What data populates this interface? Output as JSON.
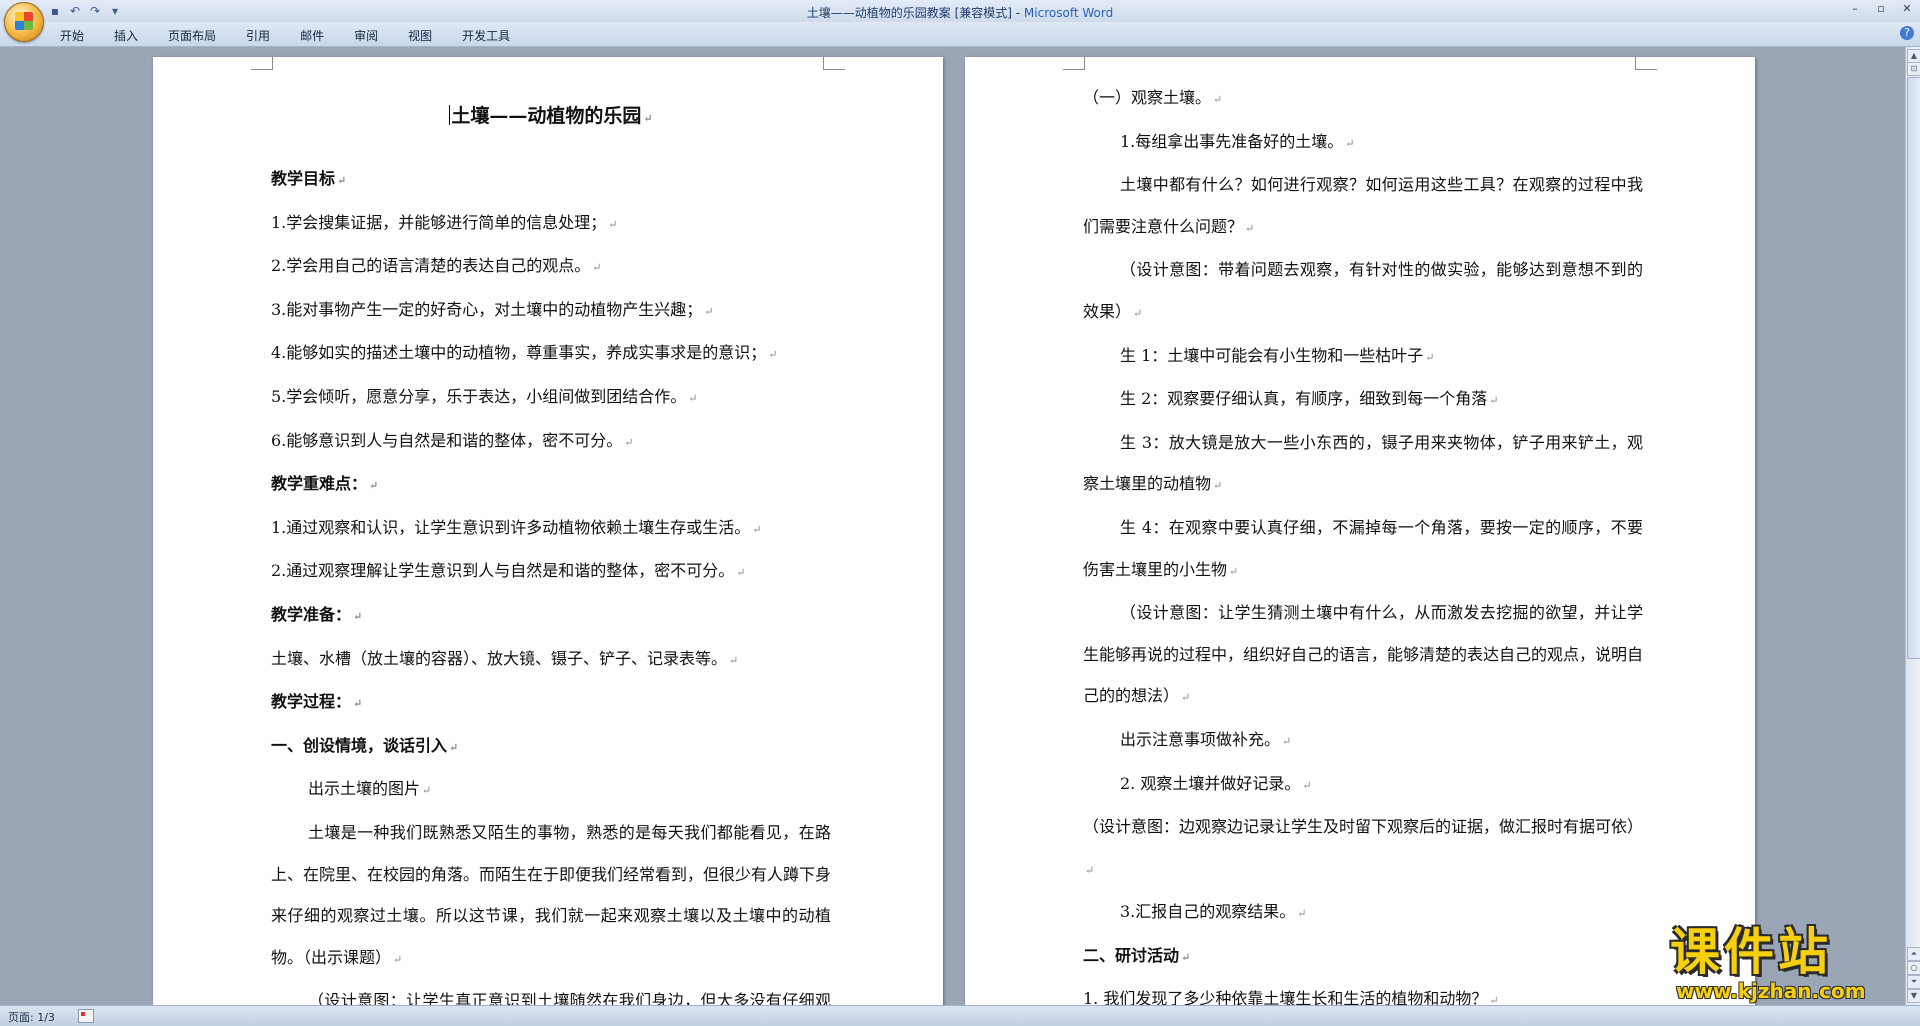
{
  "window": {
    "title": "土壤——动植物的乐园教案 [兼容模式] - ",
    "app_name": "Microsoft Word"
  },
  "quick_access": [
    {
      "name": "save-icon",
      "glyph": "▪"
    },
    {
      "name": "undo-icon",
      "glyph": "↶"
    },
    {
      "name": "redo-icon",
      "glyph": "↷"
    },
    {
      "name": "customize-icon",
      "glyph": "▾"
    }
  ],
  "ribbon": {
    "tabs": [
      "开始",
      "插入",
      "页面布局",
      "引用",
      "邮件",
      "审阅",
      "视图",
      "开发工具"
    ]
  },
  "document": {
    "left_page": {
      "title": "土壤——动植物的乐园",
      "paragraphs": [
        {
          "text": "教学目标",
          "style": "bold"
        },
        {
          "text": "1.学会搜集证据，并能够进行简单的信息处理；",
          "style": ""
        },
        {
          "text": "2.学会用自己的语言清楚的表达自己的观点。",
          "style": ""
        },
        {
          "text": "3.能对事物产生一定的好奇心，对土壤中的动植物产生兴趣；",
          "style": ""
        },
        {
          "text": "4.能够如实的描述土壤中的动植物，尊重事实，养成实事求是的意识；",
          "style": ""
        },
        {
          "text": "5.学会倾听，愿意分享，乐于表达，小组间做到团结合作。",
          "style": ""
        },
        {
          "text": "6.能够意识到人与自然是和谐的整体，密不可分。",
          "style": ""
        },
        {
          "text": "教学重难点：",
          "style": "bold"
        },
        {
          "text": "1.通过观察和认识，让学生意识到许多动植物依赖土壤生存或生活。",
          "style": ""
        },
        {
          "text": "2.通过观察理解让学生意识到人与自然是和谐的整体，密不可分。",
          "style": ""
        },
        {
          "text": "教学准备：",
          "style": "bold"
        },
        {
          "text": "土壤、水槽（放土壤的容器）、放大镜、镊子、铲子、记录表等。",
          "style": ""
        },
        {
          "text": "教学过程：",
          "style": "bold"
        },
        {
          "text": "一、创设情境，谈话引入",
          "style": "bold"
        },
        {
          "text": "出示土壤的图片",
          "style": "indent"
        },
        {
          "text": "土壤是一种我们既熟悉又陌生的事物，熟悉的是每天我们都能看见，在路上、在院里、在校园的角落。而陌生在于即便我们经常看到，但很少有人蹲下身来仔细的观察过土壤。所以这节课，我们就一起来观察土壤以及土壤中的动植物。（出示课题）",
          "style": "indent"
        },
        {
          "text": "（设计意图：让学生真正意识到土壤随然在我们身边，但大多没有仔细观察过土壤的世界，调动学生观察土壤的兴趣）",
          "style": "indent"
        }
      ]
    },
    "right_page": {
      "paragraphs": [
        {
          "text": "（一）观察土壤。",
          "style": ""
        },
        {
          "text": "1.每组拿出事先准备好的土壤。",
          "style": "indent"
        },
        {
          "text": "土壤中都有什么？如何进行观察？如何运用这些工具？在观察的过程中我们需要注意什么问题？",
          "style": "indent"
        },
        {
          "text": "（设计意图：带着问题去观察，有针对性的做实验，能够达到意想不到的效果）",
          "style": "indent"
        },
        {
          "text": "生 1：土壤中可能会有小生物和一些枯叶子",
          "style": "indent"
        },
        {
          "text": "生 2：观察要仔细认真，有顺序，细致到每一个角落",
          "style": "indent"
        },
        {
          "text": "生 3：放大镜是放大一些小东西的，镊子用来夹物体，铲子用来铲土，观察土壤里的动植物",
          "style": "indent"
        },
        {
          "text": "生 4：在观察中要认真仔细，不漏掉每一个角落，要按一定的顺序，不要伤害土壤里的小生物",
          "style": "indent"
        },
        {
          "text": "（设计意图：让学生猜测土壤中有什么，从而激发去挖掘的欲望，并让学生能够再说的过程中，组织好自己的语言，能够清楚的表达自己的观点，说明自己的的想法）",
          "style": "indent"
        },
        {
          "text": "出示注意事项做补充。",
          "style": "indent"
        },
        {
          "text": "2. 观察土壤并做好记录。",
          "style": "indent"
        },
        {
          "text": "（设计意图：边观察边记录让学生及时留下观察后的证据，做汇报时有据可依）",
          "style": ""
        },
        {
          "text": "3.汇报自己的观察结果。",
          "style": "indent"
        },
        {
          "text": "二、研讨活动",
          "style": "bold"
        },
        {
          "text": "1.  我们发现了多少种依靠土壤生长和生活的植物和动物？",
          "style": ""
        }
      ]
    }
  },
  "status": {
    "page": "页面: 1/3"
  },
  "watermark": {
    "text": "课件站",
    "url": "www.kjzhan.com"
  }
}
